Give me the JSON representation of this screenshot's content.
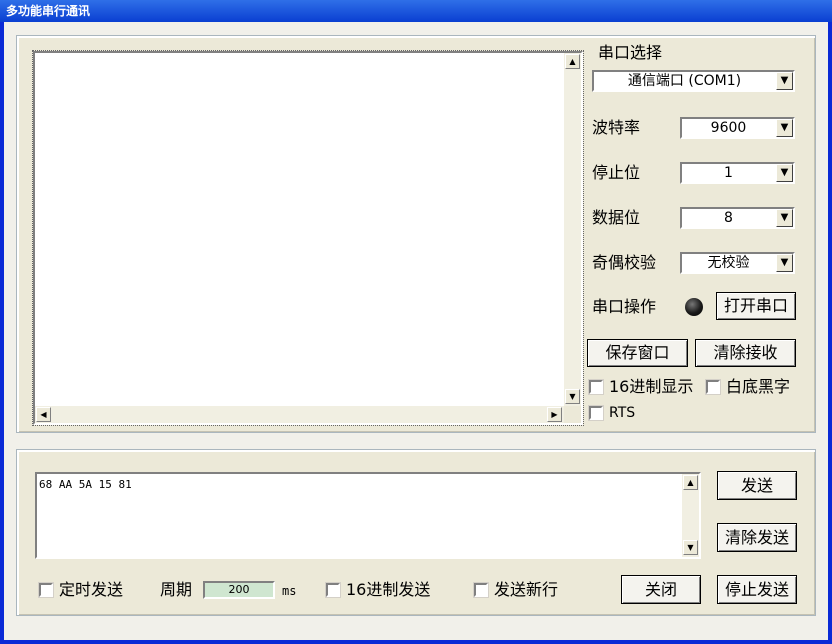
{
  "window": {
    "title": "多功能串行通讯"
  },
  "settings": {
    "port_label": "串口选择",
    "port_value": "通信端口 (COM1)",
    "baud_label": "波特率",
    "baud_value": "9600",
    "stop_label": "停止位",
    "stop_value": "1",
    "data_label": "数据位",
    "data_value": "8",
    "parity_label": "奇偶校验",
    "parity_value": "无校验",
    "op_label": "串口操作",
    "open_button": "打开串口",
    "save_button": "保存窗口",
    "clear_recv_button": "清除接收",
    "hex_display": "16进制显示",
    "white_black": "白底黑字",
    "rts": "RTS"
  },
  "receive": {
    "content": ""
  },
  "send": {
    "content": "68 AA 5A 15 81",
    "send_button": "发送",
    "clear_send_button": "清除发送",
    "timed_send": "定时发送",
    "period_label": "周期",
    "period_value": "200",
    "period_unit": "ms",
    "hex_send": "16进制发送",
    "newline": "发送新行",
    "close_button": "关闭",
    "stop_send_button": "停止发送"
  },
  "colors": {
    "titlebar": "#0a3fd2",
    "panel": "#ece9d8",
    "period_bg": "#cfe6d0"
  }
}
